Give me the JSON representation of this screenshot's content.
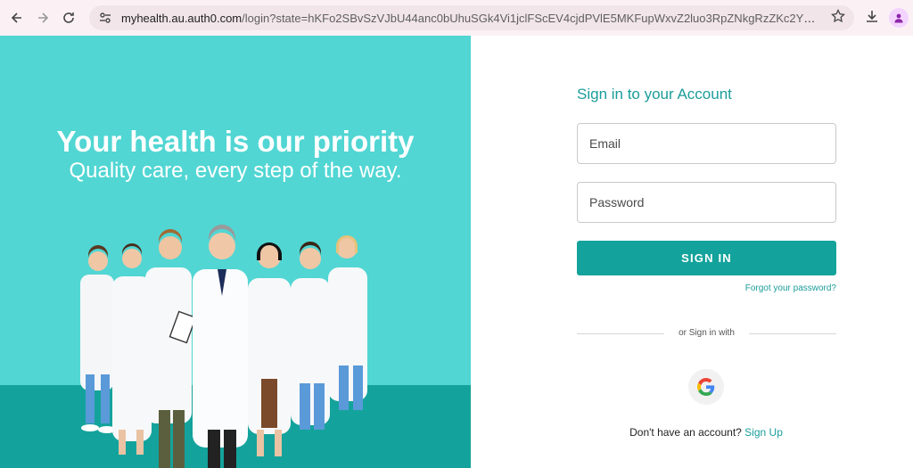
{
  "browser": {
    "url_host": "myhealth.au.auth0.com",
    "url_path": "/login?state=hKFo2SBvSzVJbU44anc0bUhuSGk4Vi1jclFScEV4cjdPVlE5MKFupWxvZ2luo3RpZNkgRzZKc2YxMmZQZDI5NFlLQlJoMkt...",
    "icons": [
      "back-icon",
      "forward-icon",
      "reload-icon",
      "site-info-icon",
      "bookmark-star-icon",
      "download-icon",
      "profile-icon"
    ]
  },
  "hero": {
    "title": "Your health is our priority",
    "subtitle": "Quality care, every step of the way.",
    "colors": {
      "background": "#51d6d3",
      "floor": "#14a39c"
    }
  },
  "login": {
    "title": "Sign in to your Account",
    "email_placeholder": "Email",
    "password_placeholder": "Password",
    "signin_label": "SIGN IN",
    "forgot_label": "Forgot your password?",
    "divider_label": "or Sign in with",
    "google_icon": "google-icon",
    "signup_prompt": "Don't have an account?",
    "signup_label": "Sign Up",
    "colors": {
      "accent": "#14a39c",
      "title": "#1a9d9a"
    }
  }
}
